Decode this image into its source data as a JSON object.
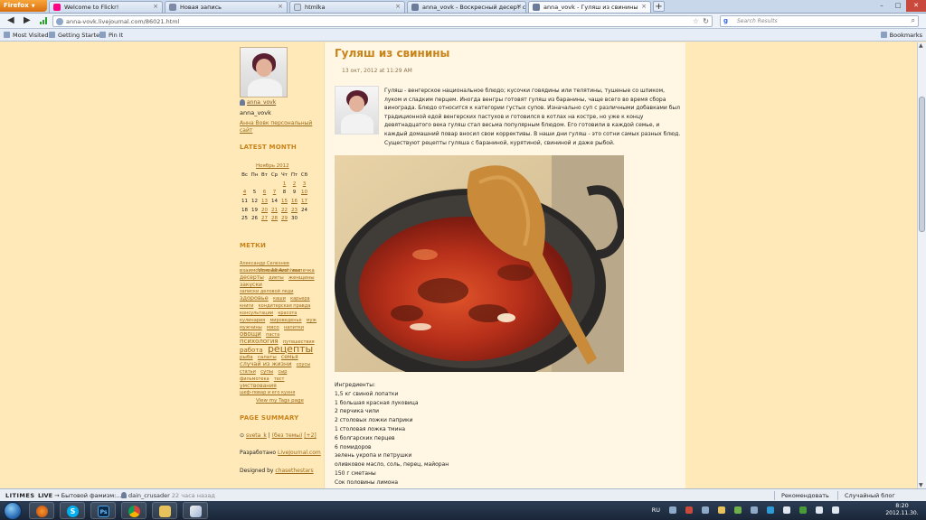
{
  "browser": {
    "menu_label": "Firefox",
    "tabs": [
      {
        "label": "Welcome to Flickr!",
        "color": "#ff0084"
      },
      {
        "label": "Новая запись",
        "color": "#7d8aa8"
      },
      {
        "label": "htmlka",
        "color": "#cfd8e6"
      },
      {
        "label": "anna_vovk - Воскресный десерт с Ф...",
        "color": "#6b7c9a"
      },
      {
        "label": "anna_vovk - Гуляш из свинины",
        "color": "#6b7c9a"
      }
    ],
    "url": "anna-vovk.livejournal.com/86021.html",
    "search_placeholder": "Search Results",
    "bookmarks": [
      "Most Visited",
      "Getting Started",
      "Pin It"
    ],
    "bookmarks_menu": "Bookmarks"
  },
  "sidebar": {
    "username_link": "anna_vovk",
    "display_name": "anna_vovk",
    "personal_site": "Анна Вовк персональный сайт",
    "latest_month_heading": "LATEST MONTH",
    "calendar": {
      "title": "Ноябрь 2012",
      "weekdays": [
        "Вс",
        "Пн",
        "Вт",
        "Ср",
        "Чт",
        "Пт",
        "Сб"
      ],
      "weeks": [
        [
          "",
          "",
          "",
          "",
          "1",
          "2",
          "3"
        ],
        [
          "4",
          "5",
          "6",
          "7",
          "8",
          "9",
          "10"
        ],
        [
          "11",
          "12",
          "13",
          "14",
          "15",
          "16",
          "17"
        ],
        [
          "18",
          "19",
          "20",
          "21",
          "22",
          "23",
          "24"
        ],
        [
          "25",
          "26",
          "27",
          "28",
          "29",
          "30",
          ""
        ]
      ],
      "linked_days": [
        "1",
        "2",
        "3",
        "4",
        "6",
        "7",
        "10",
        "13",
        "15",
        "16",
        "17",
        "20",
        "21",
        "22",
        "23",
        "27",
        "28",
        "29"
      ],
      "view_all": "View All Archives"
    },
    "tags_heading": "МЕТКИ",
    "tags": [
      {
        "label": "Александр Селезнев",
        "size": 5
      },
      {
        "label": "взаимоотношения",
        "size": 5.5
      },
      {
        "label": "выпечка",
        "size": 5.5
      },
      {
        "label": "десерты",
        "size": 6
      },
      {
        "label": "диеты",
        "size": 5
      },
      {
        "label": "женщины",
        "size": 5.5
      },
      {
        "label": "закуски",
        "size": 6
      },
      {
        "label": "записки деловой леди",
        "size": 5
      },
      {
        "label": "здоровье",
        "size": 6.5
      },
      {
        "label": "каши",
        "size": 5
      },
      {
        "label": "карьера",
        "size": 5
      },
      {
        "label": "книги",
        "size": 5
      },
      {
        "label": "кондитерская правда",
        "size": 5
      },
      {
        "label": "консультации",
        "size": 5
      },
      {
        "label": "красота",
        "size": 5
      },
      {
        "label": "кулинария",
        "size": 5
      },
      {
        "label": "мироведенье",
        "size": 5
      },
      {
        "label": "муж",
        "size": 5
      },
      {
        "label": "мужчины",
        "size": 5
      },
      {
        "label": "мясо",
        "size": 5.5
      },
      {
        "label": "напитки",
        "size": 5
      },
      {
        "label": "овощи",
        "size": 7
      },
      {
        "label": "паста",
        "size": 5
      },
      {
        "label": "психология",
        "size": 7
      },
      {
        "label": "путешествия",
        "size": 5
      },
      {
        "label": "работа",
        "size": 7
      },
      {
        "label": "рецепты",
        "size": 11
      },
      {
        "label": "рыба",
        "size": 5.5
      },
      {
        "label": "салаты",
        "size": 5.5
      },
      {
        "label": "семья",
        "size": 6
      },
      {
        "label": "случай из жизни",
        "size": 6.5
      },
      {
        "label": "соусы",
        "size": 5
      },
      {
        "label": "статьи",
        "size": 5
      },
      {
        "label": "супы",
        "size": 5.5
      },
      {
        "label": "сыр",
        "size": 5
      },
      {
        "label": "фильмотека",
        "size": 5
      },
      {
        "label": "тест",
        "size": 5
      },
      {
        "label": "умствования",
        "size": 6
      },
      {
        "label": "шеф-повар и его кухня",
        "size": 5
      }
    ],
    "view_tags": "View my Tags page",
    "summary_heading": "PAGE SUMMARY",
    "summary_user": "sveta_k",
    "summary_entry": "(без темы)",
    "summary_count": "[+2]",
    "powered_prefix": "Разработано",
    "powered_link": "LiveJournal.com",
    "designed_prefix": "Designed by",
    "designed_link": "chasethestars"
  },
  "post": {
    "title": "Гуляш из свинины",
    "date": "13 окт, 2012 at 11:29 AM",
    "intro": "Гуляш - венгерское национальное блюдо; кусочки говядины или телятины, тушеные со шпиком, луком и сладким перцем. Иногда венгры готовят гуляш из баранины, чаще всего во время сбора винограда. Блюдо относится к категории густых супов. Изначально суп с различными добавками был традиционной едой венгерских пастухов и готовился в котлах на костре, но уже к концу девятнадцатого века гуляш стал весьма популярным блюдом. Его готовили в каждой семье, и каждый домашний повар вносил свои коррективы. В наши дни гуляш - это сотни самых разных блюд. Существуют рецепты гуляша с бараниной, курятиной, свининой и даже рыбой.",
    "ingredients": [
      "Ингредиенты:",
      "1,5 кг свиной лопатки",
      "1 большая красная луковица",
      "2 перчика чили",
      "2 столовых ложки паприки",
      "1 столовая ложка тмина",
      "6 болгарских перцев",
      "6 помидоров",
      "зелень укропа и петрушки",
      "оливковое масло, соль, перец, майоран",
      "150 г сметаны",
      "Сок половины лимона"
    ]
  },
  "statusbar": {
    "lt_label": "LITIMES",
    "live_label": "LIVE",
    "live_text": "→ Бытовой фамизм:...",
    "user": "dain_crusader",
    "time_ago": "22 часа назад",
    "recommend": "Рекомендовать",
    "random_blog": "Случайный блог"
  },
  "taskbar": {
    "lang": "RU",
    "time": "8:20",
    "date": "2012.11.30."
  }
}
